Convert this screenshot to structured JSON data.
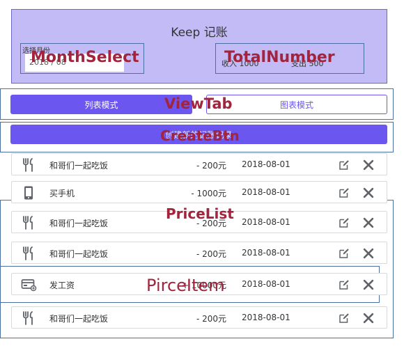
{
  "header": {
    "title": "Keep 记账",
    "month": {
      "caption": "选择月份",
      "value": "2018 / 08"
    },
    "totals": {
      "income_label": "收入 1000",
      "expense_label": "支出 500"
    }
  },
  "view_tab": {
    "list_label": "列表模式",
    "chart_label": "图表模式",
    "active": "list"
  },
  "create_button": {
    "label": "创建新的记账记录"
  },
  "annotations": {
    "month_select": "MonthSelect",
    "total_number": "TotalNumber",
    "view_tab": "ViewTab",
    "create_btn": "CreateBtn",
    "price_list": "PriceList",
    "price_item": "PirceItem"
  },
  "price_list": [
    {
      "icon": "food-icon",
      "title": "和哥们一起吃饭",
      "price": "- 200元",
      "date": "2018-08-01"
    },
    {
      "icon": "phone-icon",
      "title": "买手机",
      "price": "- 1000元",
      "date": "2018-08-01"
    },
    {
      "icon": "food-icon",
      "title": "和哥们一起吃饭",
      "price": "- 200元",
      "date": "2018-08-01"
    },
    {
      "icon": "food-icon",
      "title": "和哥们一起吃饭",
      "price": "- 200元",
      "date": "2018-08-01"
    },
    {
      "icon": "salary-card-icon",
      "title": "发工资",
      "price": "+ 10000元",
      "date": "2018-08-01"
    },
    {
      "icon": "food-icon",
      "title": "和哥们一起吃饭",
      "price": "- 200元",
      "date": "2018-08-01"
    }
  ],
  "colors": {
    "accent": "#6b56ef",
    "header_bg": "#c3bbf6",
    "annotation_text": "#a3243d",
    "annotation_frame": "#4a6fa3",
    "icon_gray": "#5f6368"
  }
}
